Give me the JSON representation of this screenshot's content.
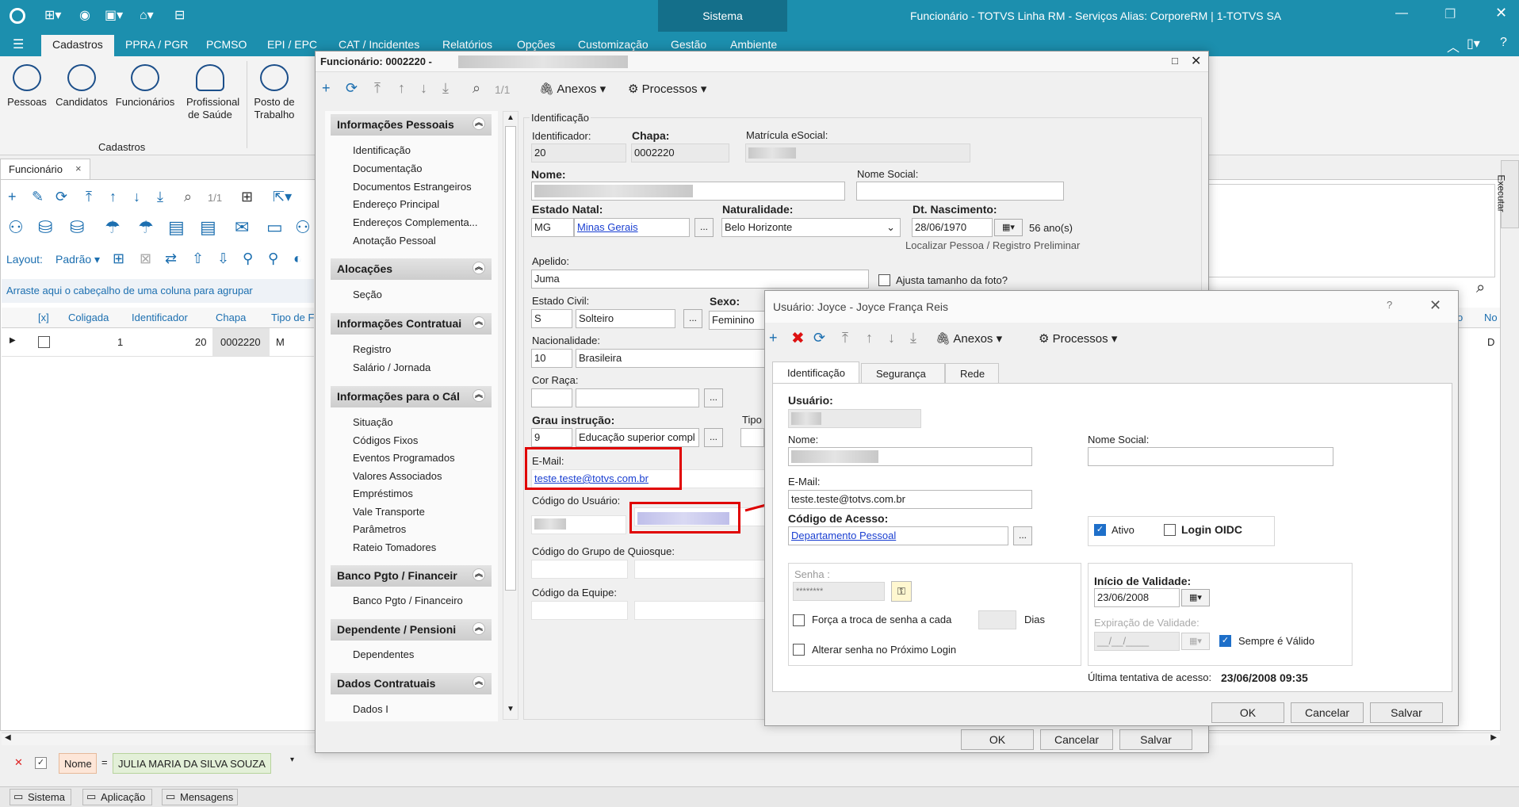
{
  "titlebar": {
    "system": "Sistema",
    "title": "Funcionário - TOTVS Linha RM - Serviços  Alias: CorporeRM | 1-TOTVS SA"
  },
  "menu_tabs": [
    "Cadastros",
    "PPRA / PGR",
    "PCMSO",
    "EPI / EPC",
    "CAT / Incidentes",
    "Relatórios",
    "Opções",
    "Customização",
    "Gestão",
    "Ambiente"
  ],
  "ribbon": {
    "buttons": [
      "Pessoas",
      "Candidatos",
      "Funcionários",
      "Profissional de Saúde",
      "Posto de Trabalho"
    ],
    "group_label": "Cadastros"
  },
  "doc_tab": "Funcionário",
  "grid": {
    "paging": "1/1",
    "layout_label": "Layout:",
    "layout_value": "Padrão",
    "group_hint": "Arraste aqui o cabeçalho de uma coluna para agrupar",
    "columns": [
      "[x]",
      "Coligada",
      "Identificador",
      "Chapa",
      "Tipo de F"
    ],
    "row": {
      "coligada": "1",
      "identificador": "20",
      "chapa": "0002220",
      "tipo": "M"
    },
    "right_columns": [
      "o",
      "No"
    ],
    "right_row": "D"
  },
  "filter": {
    "field": "Nome",
    "op": "=",
    "value": "JULIA MARIA DA SILVA SOUZA"
  },
  "statusbar": [
    "Sistema",
    "Aplicação",
    "Mensagens"
  ],
  "side_tab": "Executar",
  "func_window": {
    "title": "Funcionário: 0002220 -",
    "paging": "1/1",
    "anexos": "Anexos",
    "processos": "Processos",
    "sections": [
      {
        "title": "Informações Pessoais",
        "items": [
          "Identificação",
          "Documentação",
          "Documentos Estrangeiros",
          "Endereço Principal",
          "Endereços Complementa...",
          "Anotação Pessoal"
        ]
      },
      {
        "title": "Alocações",
        "items": [
          "Seção"
        ]
      },
      {
        "title": "Informações Contratuai",
        "items": [
          "Registro",
          "Salário / Jornada"
        ]
      },
      {
        "title": "Informações para o Cál",
        "items": [
          "Situação",
          "Códigos Fixos",
          "Eventos Programados",
          "Valores Associados",
          "Empréstimos",
          "Vale Transporte",
          "Parâmetros",
          "Rateio Tomadores"
        ]
      },
      {
        "title": "Banco Pgto / Financeir",
        "items": [
          "Banco Pgto / Financeiro"
        ]
      },
      {
        "title": "Dependente / Pensioni",
        "items": [
          "Dependentes"
        ]
      },
      {
        "title": "Dados Contratuais",
        "items": [
          "Dados I"
        ]
      }
    ],
    "form": {
      "group": "Identificação",
      "identificador_label": "Identificador:",
      "identificador": "20",
      "chapa_label": "Chapa:",
      "chapa": "0002220",
      "matricula_label": "Matrícula eSocial:",
      "nome_label": "Nome:",
      "nome_social_label": "Nome Social:",
      "estado_natal_label": "Estado Natal:",
      "estado_natal": "MG",
      "estado_natal_desc": "Minas Gerais",
      "naturalidade_label": "Naturalidade:",
      "naturalidade": "Belo Horizonte",
      "nascimento_label": "Dt. Nascimento:",
      "nascimento": "28/06/1970",
      "idade": "56 ano(s)",
      "localizar": "Localizar Pessoa / Registro Preliminar",
      "apelido_label": "Apelido:",
      "apelido": "Juma",
      "ajusta_foto": "Ajusta tamanho da foto?",
      "estado_civil_label": "Estado Civil:",
      "estado_civil": "S",
      "estado_civil_desc": "Solteiro",
      "sexo_label": "Sexo:",
      "sexo": "Feminino",
      "nacionalidade_label": "Nacionalidade:",
      "nacionalidade": "10",
      "nacionalidade_desc": "Brasileira",
      "cor_raca_label": "Cor Raça:",
      "grau_label": "Grau instrução:",
      "grau": "9",
      "grau_desc": "Educação superior compl",
      "tipo_label": "Tipo",
      "email_label": "E-Mail:",
      "email": "teste.teste@totvs.com.br",
      "codigo_usuario_label": "Código do Usuário:",
      "quiosque_label": "Código do Grupo de Quiosque:",
      "equipe_label": "Código da Equipe:"
    },
    "buttons": {
      "ok": "OK",
      "cancelar": "Cancelar",
      "salvar": "Salvar"
    }
  },
  "user_window": {
    "title": "Usuário: Joyce - Joyce França Reis",
    "help": "?",
    "anexos": "Anexos",
    "processos": "Processos",
    "tabs": [
      "Identificação",
      "Segurança",
      "Rede"
    ],
    "usuario_label": "Usuário:",
    "nome_label": "Nome:",
    "nome_social_label": "Nome Social:",
    "email_label": "E-Mail:",
    "email": "teste.teste@totvs.com.br",
    "codigo_acesso_label": "Código de Acesso:",
    "codigo_acesso": "Departamento Pessoal",
    "ativo": "Ativo",
    "login_oidc": "Login OIDC",
    "senha_label": "Senha :",
    "senha": "********",
    "forca_troca": "Força a troca de senha a cada",
    "dias": "Dias",
    "alterar_senha": "Alterar senha no Próximo Login",
    "inicio_label": "Início de Validade:",
    "inicio": "23/06/2008",
    "expiracao_label": "Expiração de Validade:",
    "expiracao": "__/__/____",
    "sempre_valido": "Sempre é Válido",
    "ultima_label": "Última tentativa de acesso:",
    "ultima": "23/06/2008 09:35",
    "buttons": {
      "ok": "OK",
      "cancelar": "Cancelar",
      "salvar": "Salvar"
    }
  },
  "colors": {
    "accent": "#1c8fae",
    "dark_accent": "#146f8a",
    "highlight": "#e00000",
    "link": "#1a3fd1"
  }
}
